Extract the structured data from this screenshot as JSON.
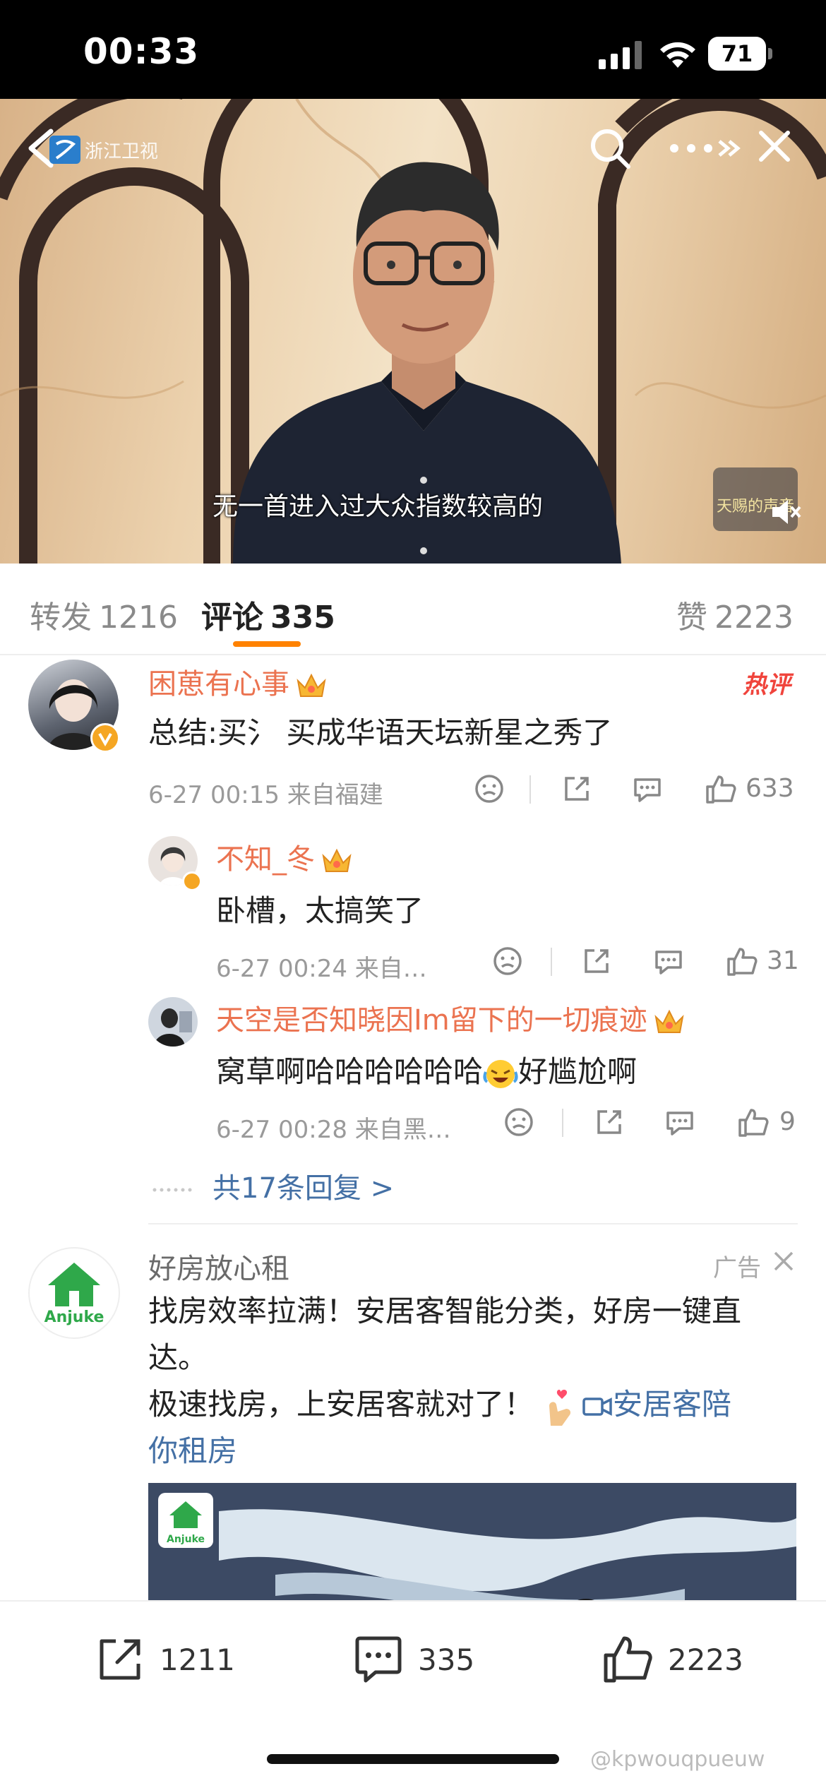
{
  "status_bar": {
    "time": "00:33",
    "battery": "71"
  },
  "video": {
    "channel_logo_text": "浙江卫视",
    "subtitle": "无一首进入过大众指数较高的",
    "show_logo_text": "天赐的声音"
  },
  "tabs": [
    {
      "label": "转发",
      "count": "1216"
    },
    {
      "label": "评论",
      "count": "335"
    },
    {
      "label": "赞",
      "count": "2223"
    }
  ],
  "main_comment": {
    "username": "困葸有心事",
    "text": "总结:买氵 买成华语天坛新星之秀了",
    "time_location": "6-27 00:15 来自福建",
    "likes": "633",
    "badge": "热评"
  },
  "replies": [
    {
      "username": "不知_冬",
      "text": "卧槽，太搞笑了",
      "time_location": "6-27 00:24 来自…",
      "likes": "31"
    },
    {
      "username": "天空是否知晓因Im留下的一切痕迹",
      "text_before_emoji": "窝草啊哈哈哈哈哈哈",
      "text_after_emoji": "好尴尬啊",
      "time_location": "6-27 00:28 来自黑…",
      "likes": "9"
    }
  ],
  "more_replies": "共17条回复 >",
  "ad": {
    "name": "好房放心租",
    "tag": "广告",
    "logo_text": "Anjuke",
    "line1": "找房效率拉满！安居客智能分类，好房一键直",
    "line2": "达。",
    "line3": "极速找房，上安居客就对了！",
    "link_text_1": "安居客陪",
    "link_text_2": "你租房",
    "image_logo_text": "Anjuke"
  },
  "bottom_bar": {
    "repost": "1211",
    "comment": "335",
    "like": "2223"
  },
  "watermark": "@kpwouqpueuw",
  "colors": {
    "accent": "#ff8200",
    "username": "#eb7350",
    "link": "#4470a5",
    "hot": "#f0443c"
  }
}
